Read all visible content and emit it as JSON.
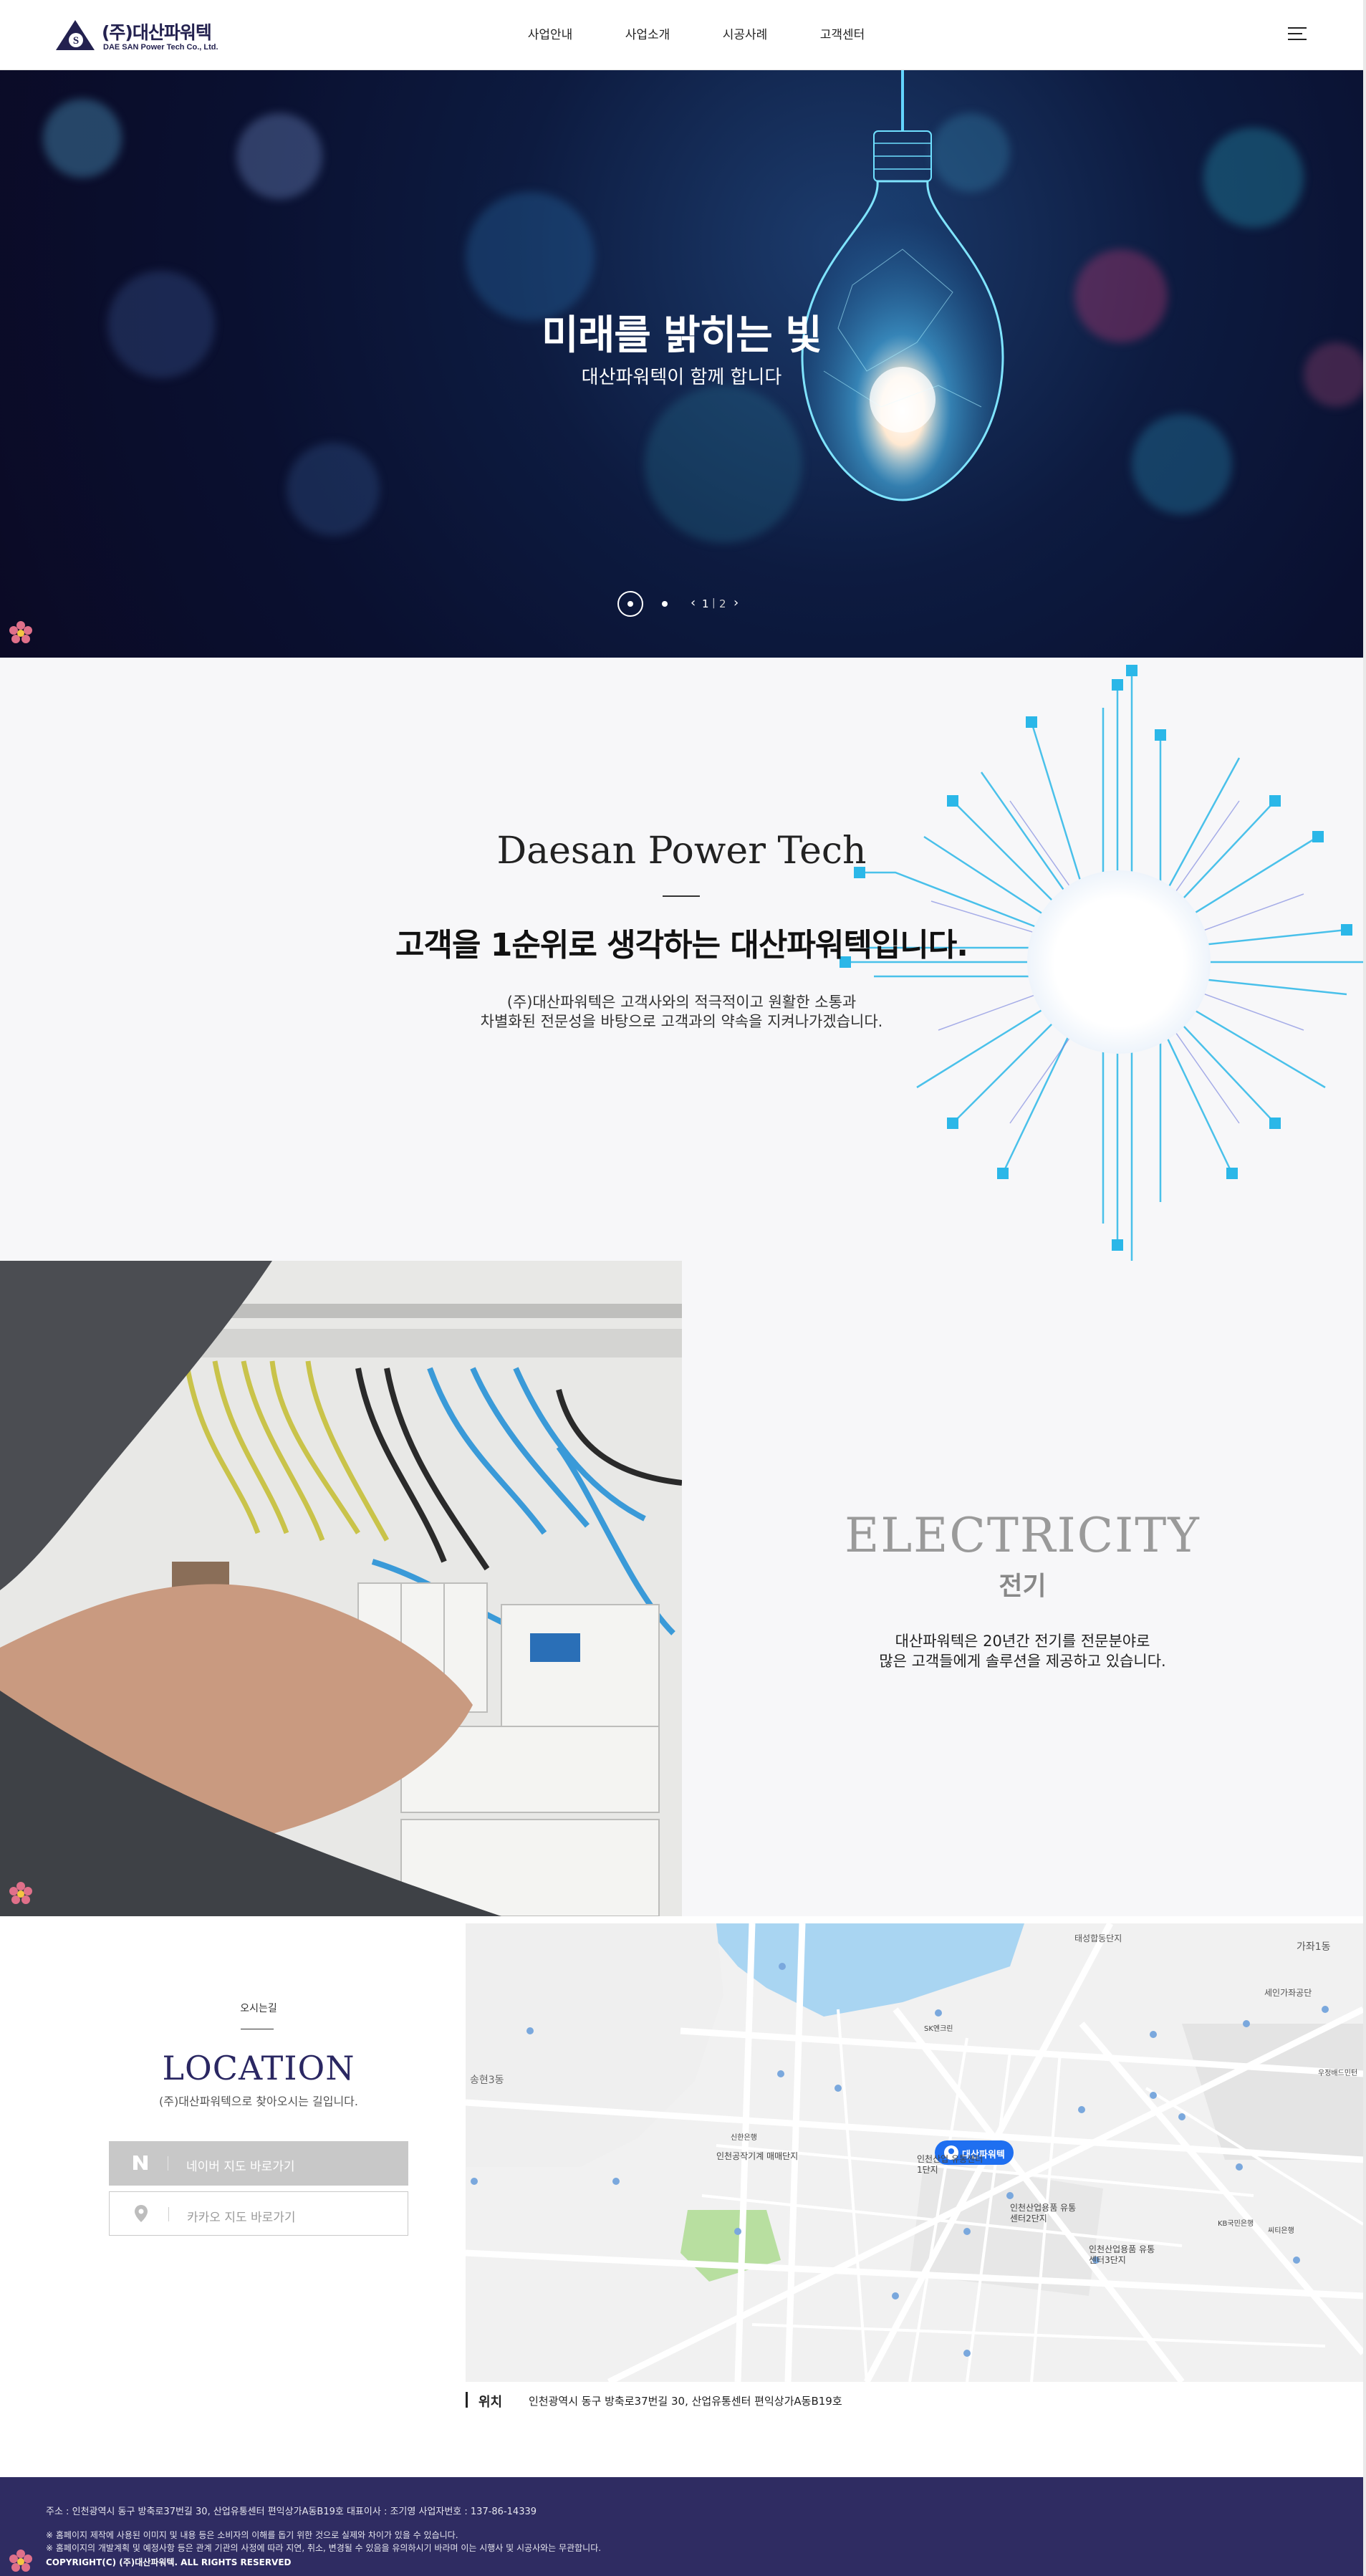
{
  "header": {
    "logo_ko": "(주)대산파워텍",
    "logo_en": "DAE SAN Power Tech Co., Ltd.",
    "nav": [
      "사업안내",
      "사업소개",
      "시공사례",
      "고객센터"
    ],
    "menu_icon": "hamburger-icon"
  },
  "hero": {
    "title": "미래를 밝히는 빛",
    "subtitle": "대산파워텍이 함께 합니다",
    "pager": {
      "current": "1",
      "separator": "|",
      "total": "2"
    }
  },
  "about": {
    "title_en": "Daesan Power Tech",
    "title_ko": "고객을 1순위로 생각하는 대산파워텍입니다.",
    "lines": [
      "(주)대산파워텍은 고객사와의 적극적이고 원활한 소통과",
      "차별화된 전문성을 바탕으로 고객과의 약속을 지켜나가겠습니다."
    ]
  },
  "electricity": {
    "title_en": "ELECTRICITY",
    "title_ko": "전기",
    "lines": [
      "대산파워텍은 20년간 전기를 전문분야로",
      "많은 고객들에게 솔루션을 제공하고 있습니다."
    ]
  },
  "location": {
    "label": "오시는길",
    "title": "LOCATION",
    "subtitle": "(주)대산파워텍으로 찾아오시는 길입니다.",
    "naver_button": "네이버 지도 바로가기",
    "kakao_button": "카카오 지도 바로가기",
    "address_label": "위치",
    "address": "인천광역시 동구 방축로37번길 30, 산업유통센터 편익상가A동B19호",
    "map": {
      "marker_label": "대산파워텍",
      "labels": [
        "태성합동단지",
        "가좌1동",
        "세인가좌공단",
        "송현3동",
        "인천공작기계 매매단지",
        "인천산업 유통센터1단지",
        "인천산업용품 유통센터2단지",
        "인천산업용품 유통센터3단지",
        "KB국민은행",
        "신한은행",
        "SK엔크린",
        "우정배드민턴",
        "씨티은행"
      ]
    }
  },
  "footer": {
    "line1": "주소 : 인천광역시 동구 방축로37번길 30, 산업유통센터 편익상가A동B19호    대표이사 : 조기영    사업자번호 : 137-86-14339",
    "line2": "※ 홈페이지 제작에 사용된 이미지 및 내용 등은 소비자의 이해를 돕기 위한 것으로 실제와 차이가 있을 수 있습니다.",
    "line3": "※ 홈페이지의 개발계획 및 예정사항 등은 관계 기관의 사정에 따라 지연, 취소, 변경될 수 있음을 유의하시기 바라며 이는 시행사 및 시공사와는 무관합니다.",
    "copyright": "COPYRIGHT(C) (주)대산파워텍. ALL RIGHTS RESERVED"
  },
  "colors": {
    "brand_navy": "#2f2c62",
    "location_title": "#2a2762",
    "marker_blue": "#1f6ff0"
  }
}
